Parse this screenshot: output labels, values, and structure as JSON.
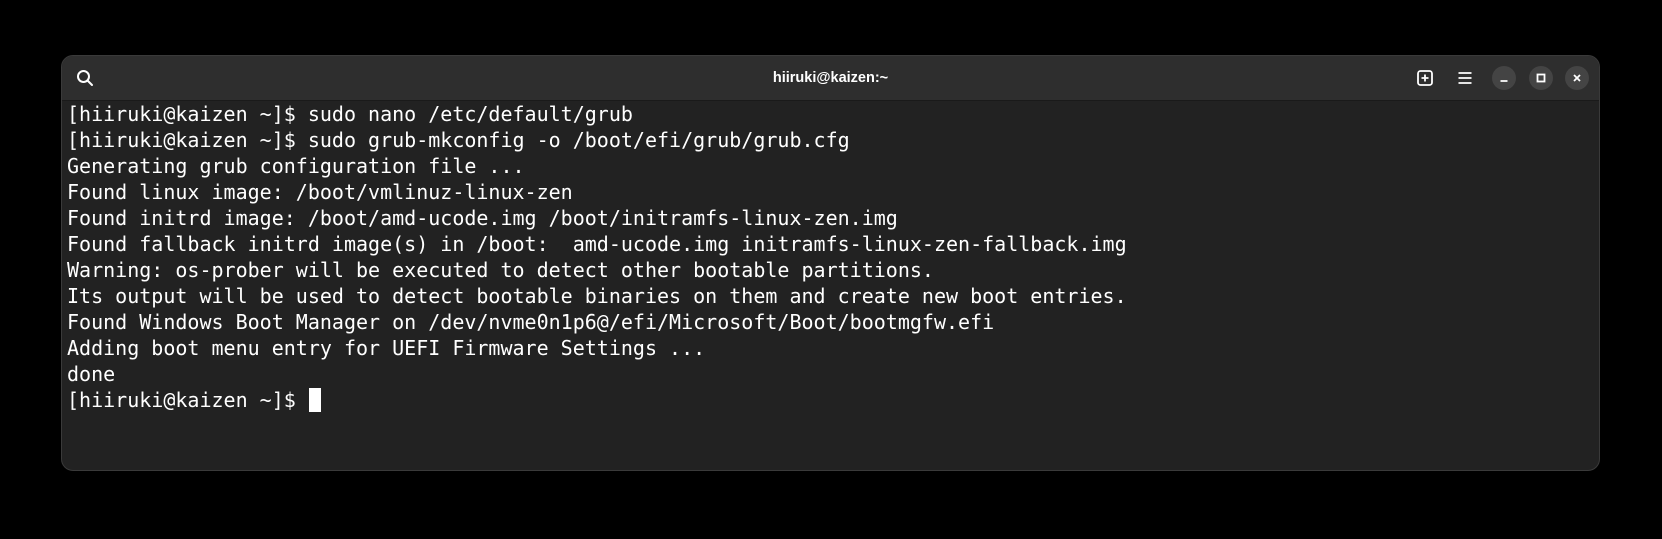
{
  "window": {
    "title": "hiiruki@kaizen:~"
  },
  "titlebar": {
    "buttons": {
      "search": "search-icon",
      "new_tab": "new-tab-icon",
      "menu": "hamburger-menu-icon",
      "minimize": "minimize-icon",
      "maximize": "maximize-icon",
      "close": "close-icon"
    }
  },
  "terminal": {
    "lines": [
      "[hiiruki@kaizen ~]$ sudo nano /etc/default/grub",
      "[hiiruki@kaizen ~]$ sudo grub-mkconfig -o /boot/efi/grub/grub.cfg",
      "Generating grub configuration file ...",
      "Found linux image: /boot/vmlinuz-linux-zen",
      "Found initrd image: /boot/amd-ucode.img /boot/initramfs-linux-zen.img",
      "Found fallback initrd image(s) in /boot:  amd-ucode.img initramfs-linux-zen-fallback.img",
      "Warning: os-prober will be executed to detect other bootable partitions.",
      "Its output will be used to detect bootable binaries on them and create new boot entries.",
      "Found Windows Boot Manager on /dev/nvme0n1p6@/efi/Microsoft/Boot/bootmgfw.efi",
      "Adding boot menu entry for UEFI Firmware Settings ...",
      "done"
    ],
    "prompt": "[hiiruki@kaizen ~]$ "
  },
  "colors": {
    "background": "#000000",
    "window": "#222222",
    "titlebar": "#2e2e2e",
    "text": "#ffffff"
  }
}
